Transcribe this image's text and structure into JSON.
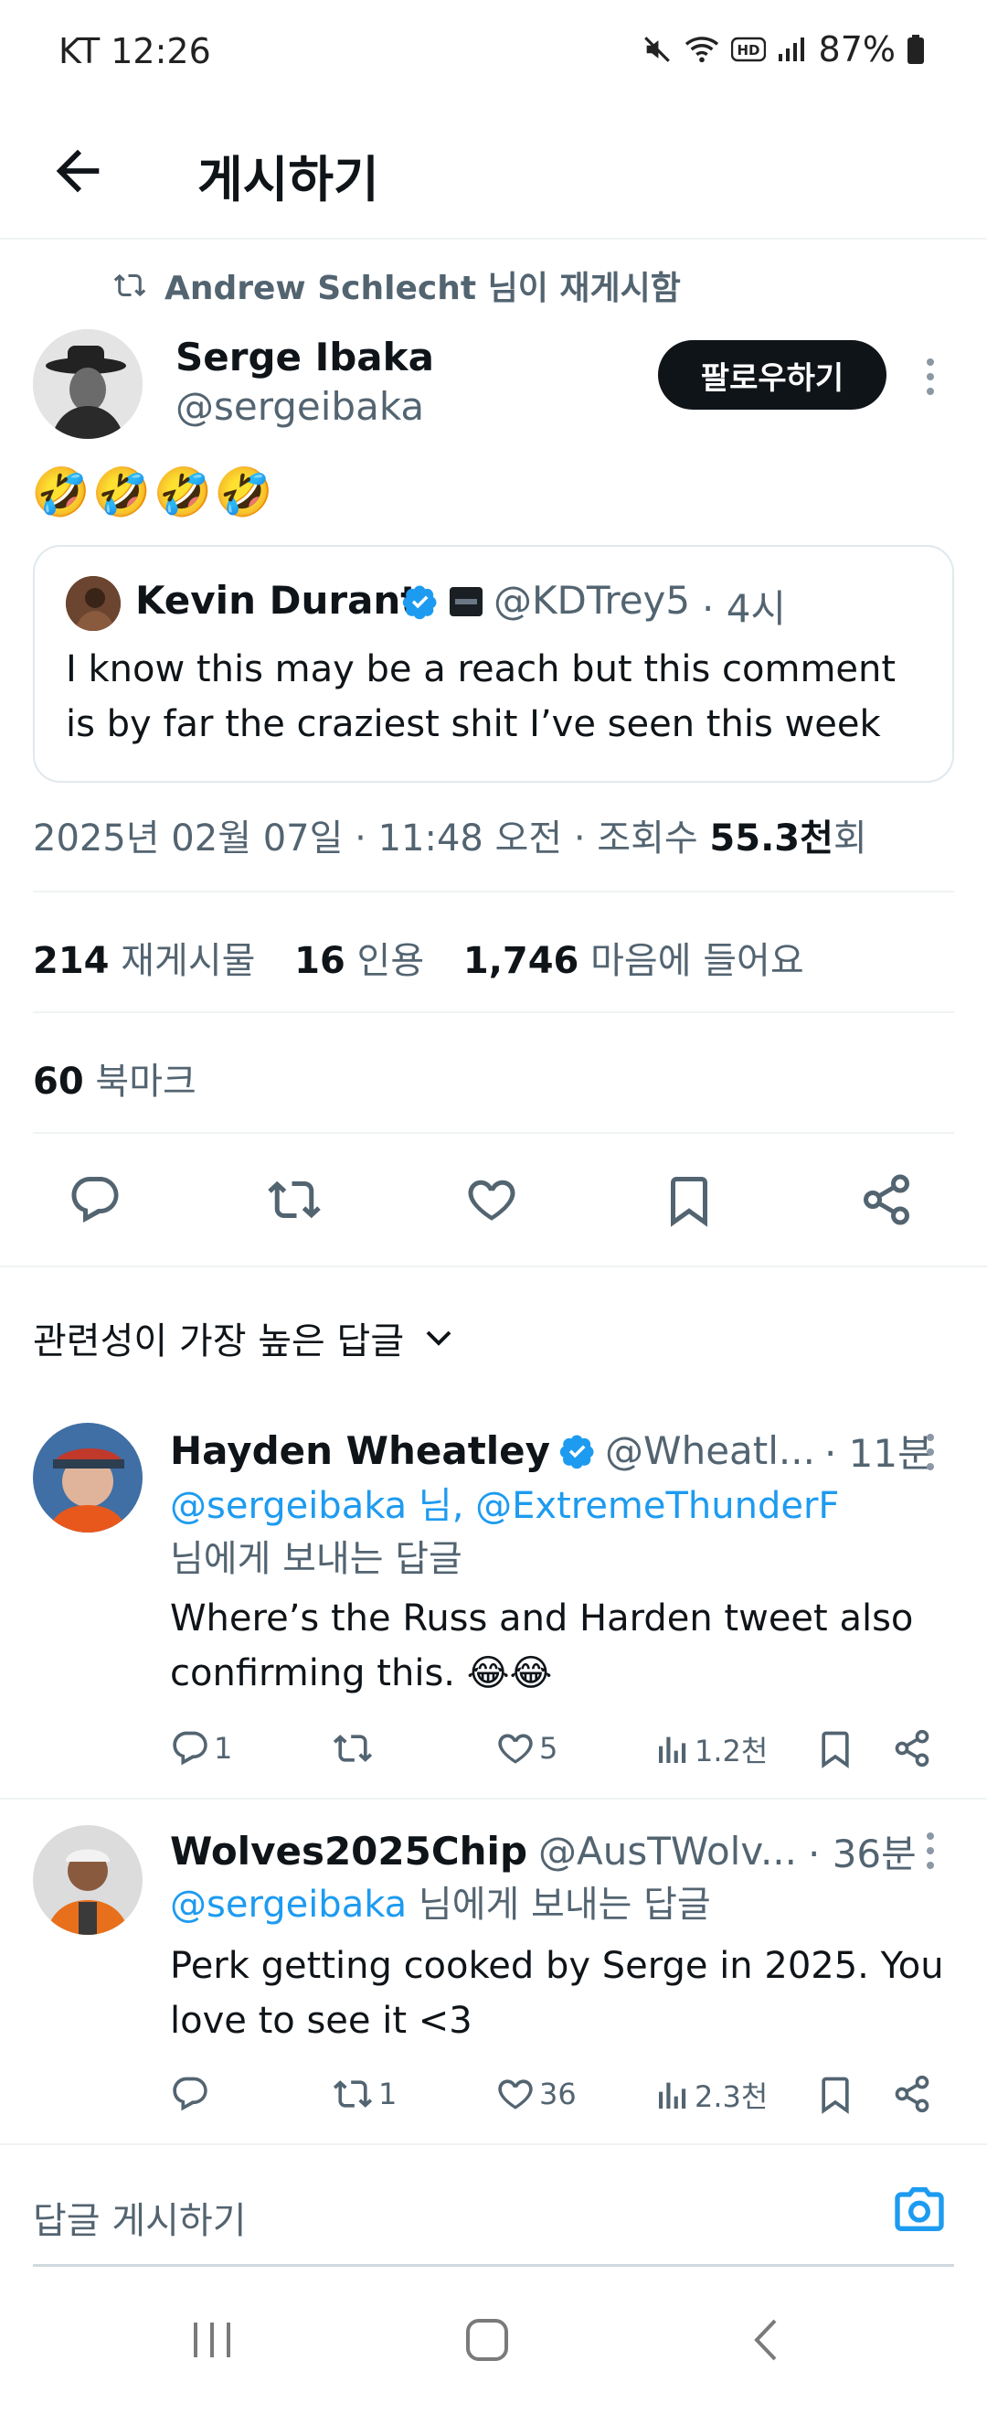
{
  "status_bar": {
    "time": "KT 12:26",
    "battery": "87%"
  },
  "header": {
    "title": "게시하기"
  },
  "repost": {
    "text": "Andrew Schlecht 님이 재게시함"
  },
  "post": {
    "author_name": "Serge Ibaka",
    "author_handle": "@sergeibaka",
    "follow_label": "팔로우하기",
    "text": "🤣🤣🤣🤣",
    "quote": {
      "author_name": "Kevin Durant",
      "author_handle": "@KDTrey5",
      "time": "· 4시",
      "text": "I know this may be a reach but this comment is by far the craziest shit I’ve seen this week"
    },
    "meta_prefix": "2025년 02월 07일 · 11:48 오전 · 조회수 ",
    "views_value": "55.3천",
    "views_suffix": "회",
    "stats": {
      "reposts_count": "214",
      "reposts_label": "재게시물",
      "quotes_count": "16",
      "quotes_label": "인용",
      "likes_count": "1,746",
      "likes_label": "마음에 들어요",
      "bookmarks_count": "60",
      "bookmarks_label": "북마크"
    }
  },
  "replies_sort": {
    "label": "관련성이 가장 높은 답글"
  },
  "replies": [
    {
      "name": "Hayden Wheatley",
      "handle": "@Wheatl...",
      "time": "· 11분",
      "to_mentions": "@sergeibaka 님, @ExtremeThunderF",
      "to_suffix": "님에게 보내는 답글",
      "text": "Where’s the Russ and Harden tweet also confirming this. 😂😂",
      "reply_count": "1",
      "repost_count": "",
      "like_count": "5",
      "view_count": "1.2천"
    },
    {
      "name": "Wolves2025Chip",
      "handle": "@AusTWolv...",
      "time": "· 36분",
      "to_mentions": "@sergeibaka",
      "to_suffix": " 님에게 보내는 답글",
      "text": "Perk getting cooked by Serge in 2025. You love to see it <3",
      "reply_count": "",
      "repost_count": "1",
      "like_count": "36",
      "view_count": "2.3천"
    }
  ],
  "reply_composer": {
    "placeholder": "답글 게시하기"
  },
  "colors": {
    "accent": "#1d9bf0",
    "text": "#0f1419",
    "secondary": "#536471",
    "divider": "#eff3f4"
  }
}
